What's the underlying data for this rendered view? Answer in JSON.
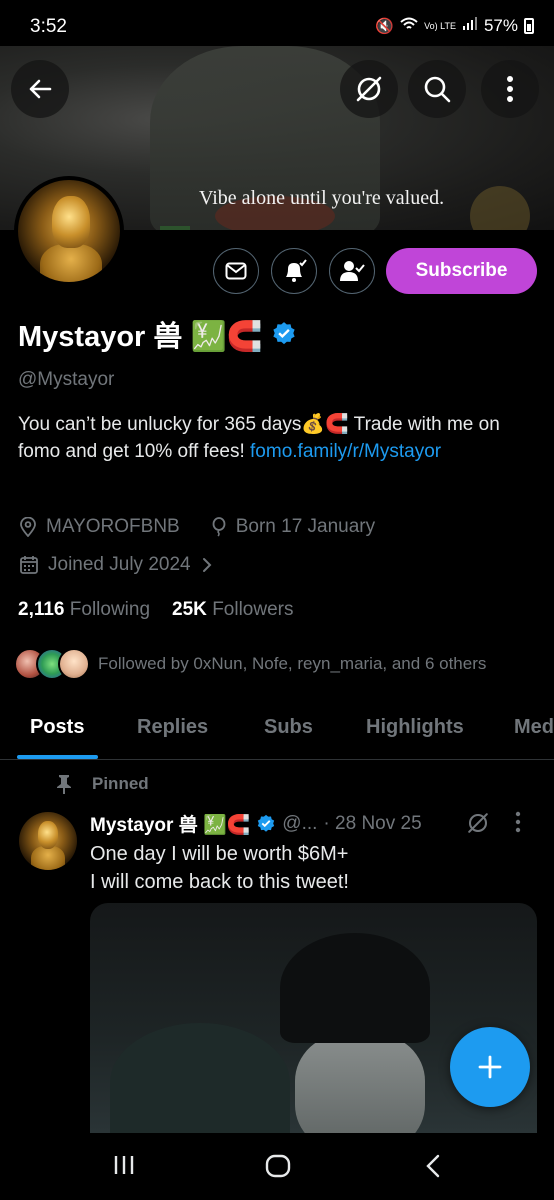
{
  "status_bar": {
    "time": "3:52",
    "battery": "57%",
    "network_label": "Vo) LTE"
  },
  "banner": {
    "caption": "Vibe alone until you're valued."
  },
  "profile": {
    "display_name": "Mystayor 兽 💹🧲",
    "handle": "@Mystayor",
    "bio_text": "You can’t be unlucky for 365 days💰🧲 Trade with me on fomo and get 10% off fees! ",
    "bio_link": "fomo.family/r/Mystayor",
    "location": "MAYOROFBNB",
    "birthday": "Born 17 January",
    "joined": "Joined July 2024",
    "following_count": "2,116",
    "following_label": "Following",
    "followers_count": "25K",
    "followers_label": "Followers",
    "followed_by": "Followed by 0xNun, Nofe, reyn_maria, and 6 others",
    "subscribe_label": "Subscribe"
  },
  "tabs": [
    {
      "label": "Posts",
      "active": true
    },
    {
      "label": "Replies",
      "active": false
    },
    {
      "label": "Subs",
      "active": false
    },
    {
      "label": "Highlights",
      "active": false
    },
    {
      "label": "Med",
      "active": false
    }
  ],
  "tweet": {
    "pinned_label": "Pinned",
    "author_name": "Mystayor 兽 💹🧲",
    "author_handle": "@...",
    "date": "· 28 Nov 25",
    "line1": "One day I will be worth $6M+",
    "line2": "I will come back to this tweet!"
  },
  "colors": {
    "accent": "#1d9bf0",
    "subscribe": "#c045d8",
    "muted": "#71767b",
    "background": "#000000"
  },
  "icons": [
    "back-arrow-icon",
    "grok-icon",
    "search-icon",
    "more-vertical-icon",
    "message-icon",
    "bell-icon",
    "follow-check-icon",
    "verified-icon",
    "location-icon",
    "birthday-icon",
    "calendar-icon",
    "chevron-right-icon",
    "pin-icon",
    "plus-icon",
    "nav-recents-icon",
    "nav-home-icon",
    "nav-back-icon"
  ]
}
